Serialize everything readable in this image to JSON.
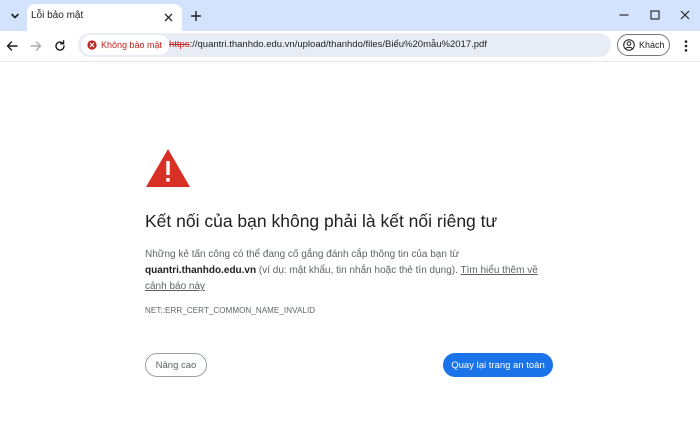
{
  "browser": {
    "tab_title": "Lỗi bảo mật",
    "security_chip_label": "Không bảo mật",
    "url_scheme": "https",
    "url_rest": "://quantri.thanhdo.edu.vn/upload/thanhdo/files/Biểu%20mẫu%2017.pdf",
    "profile_label": "Khách"
  },
  "page": {
    "heading": "Kết nối của bạn không phải là kết nối riêng tư",
    "desc_before": "Những kẻ tấn công có thể đang cố gắng đánh cắp thông tin của bạn từ ",
    "desc_domain": "quantri.thanhdo.edu.vn",
    "desc_after": " (ví dụ: mật khẩu, tin nhắn hoặc thẻ tín dụng). ",
    "learn_more_link": "Tìm hiểu thêm về cảnh báo này",
    "error_code": "NET::ERR_CERT_COMMON_NAME_INVALID",
    "advanced_button": "Nâng cao",
    "back_button": "Quay lại trang an toàn"
  },
  "colors": {
    "tabstrip_bg": "#d3e3fd",
    "warning_red": "#d93025",
    "primary_blue": "#1a73e8"
  },
  "icons": [
    "tab-search-icon",
    "close-icon",
    "plus-icon",
    "minimize-icon",
    "maximize-icon",
    "window-close-icon",
    "back-arrow-icon",
    "forward-arrow-icon",
    "reload-icon",
    "warning-circle-icon",
    "profile-icon",
    "more-vert-icon",
    "warning-triangle-icon"
  ]
}
